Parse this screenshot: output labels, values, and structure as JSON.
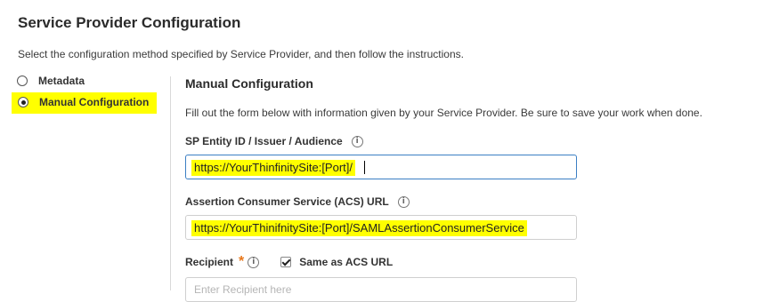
{
  "page": {
    "title": "Service Provider Configuration",
    "intro": "Select the configuration method specified by Service Provider, and then follow the instructions."
  },
  "method_options": [
    {
      "label": "Metadata",
      "selected": false
    },
    {
      "label": "Manual Configuration",
      "selected": true
    }
  ],
  "manual": {
    "title": "Manual Configuration",
    "description": "Fill out the form below with information given by your Service Provider. Be sure to save your work when done.",
    "entity_id": {
      "label": "SP Entity ID / Issuer / Audience",
      "value": "https://YourThinfinitySite:[Port]/"
    },
    "acs_url": {
      "label": "Assertion Consumer Service (ACS) URL",
      "value": "https://YourThinifnitySite:[Port]/SAMLAssertionConsumerService"
    },
    "recipient": {
      "label": "Recipient",
      "required_mark": "*",
      "same_as_label": "Same as ACS URL",
      "same_as_checked": true,
      "placeholder": "Enter Recipient here"
    }
  },
  "colors": {
    "highlight": "#ffff00",
    "required": "#e8771a",
    "focus_border": "#3b7fc4"
  },
  "icons": {
    "info": "info-icon",
    "check": "checkmark-icon"
  }
}
